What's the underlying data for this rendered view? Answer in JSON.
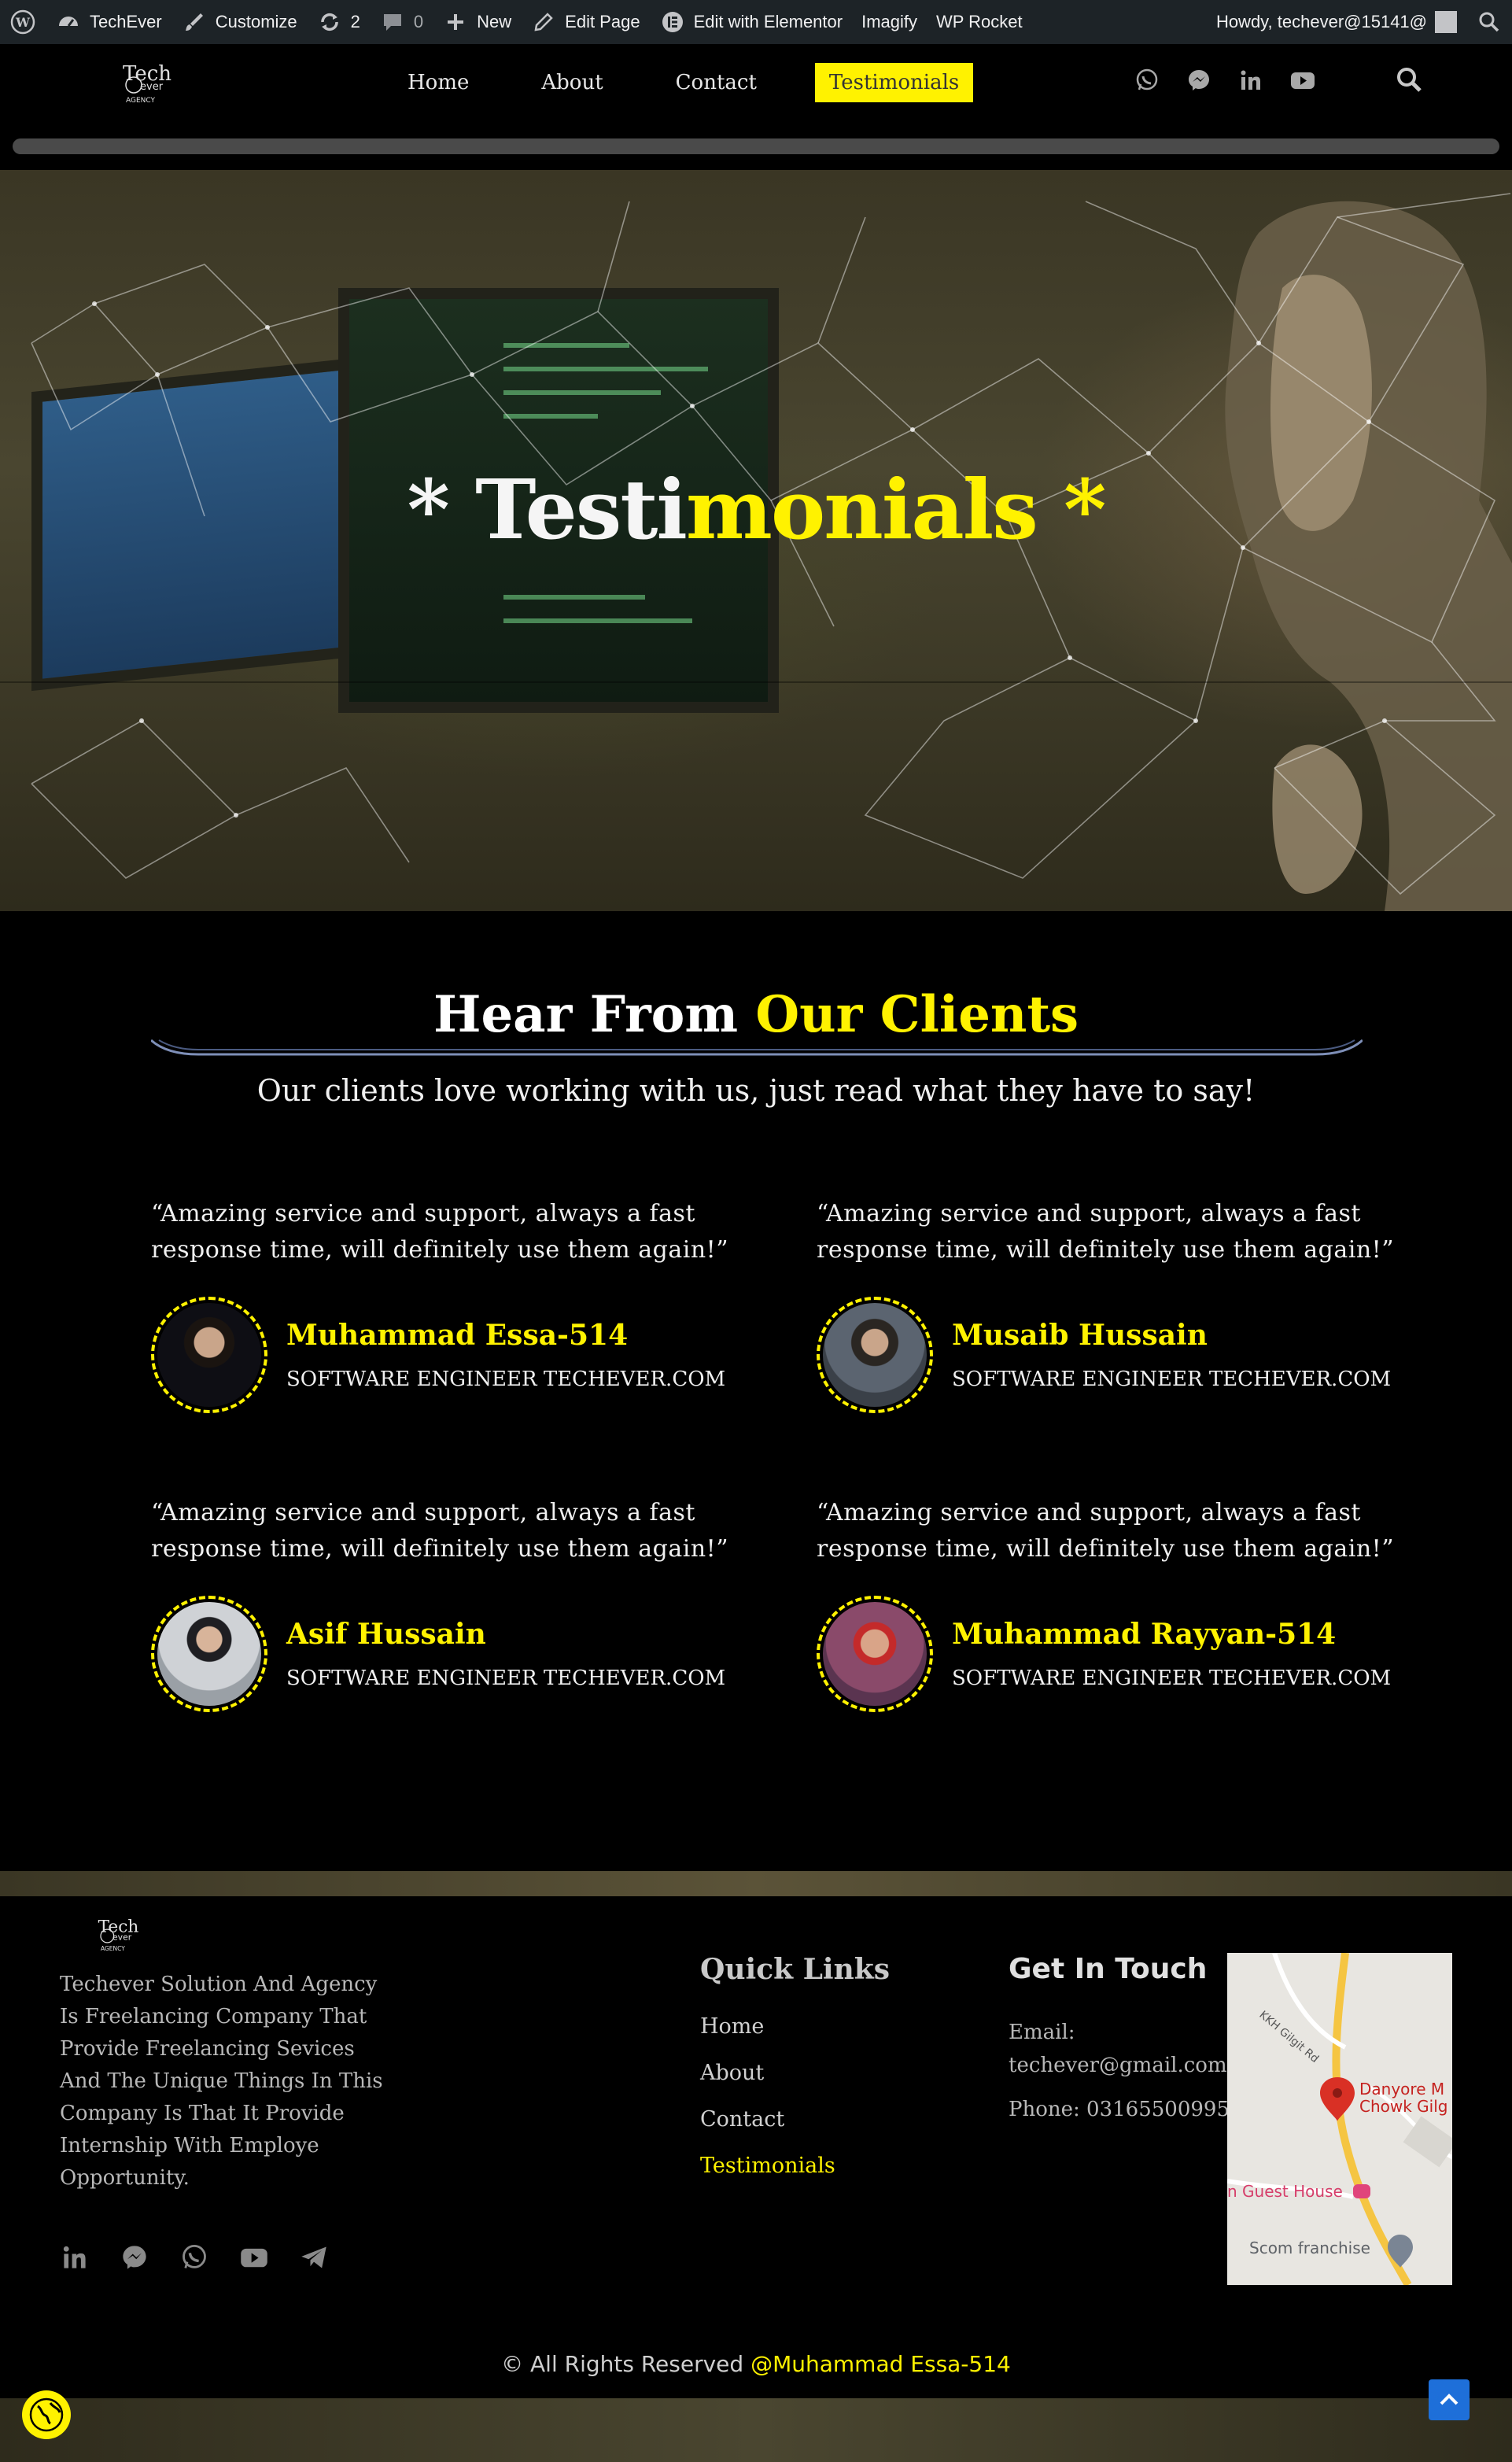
{
  "adminbar": {
    "site_name": "TechEver",
    "customize": "Customize",
    "updates_count": "2",
    "comments_count": "0",
    "new": "New",
    "edit_page": "Edit Page",
    "edit_elementor": "Edit with Elementor",
    "imagify": "Imagify",
    "wp_rocket": "WP Rocket",
    "howdy": "Howdy, techever@15141@"
  },
  "logo": {
    "line1": "Tech",
    "line2": "ever",
    "line3": "AGENCY"
  },
  "nav": {
    "items": [
      {
        "label": "Home",
        "active": false
      },
      {
        "label": "About",
        "active": false
      },
      {
        "label": "Contact",
        "active": false
      },
      {
        "label": "Testimonials",
        "active": true
      }
    ]
  },
  "social_top": [
    "whatsapp-icon",
    "messenger-icon",
    "linkedin-icon",
    "youtube-icon"
  ],
  "hero": {
    "title_pre": "* Testi",
    "title_highlight": "monials *"
  },
  "clients": {
    "title_white": "Hear From ",
    "title_yellow": "Our Clients",
    "subtitle": "Our clients love working with us, just read what they have to say!",
    "testimonials": [
      {
        "quote": "“Amazing service and support, always a fast response time, will definitely use them again!”",
        "name": "Muhammad Essa-514",
        "role": "SOFTWARE ENGINEER TECHEVER.COM"
      },
      {
        "quote": "“Amazing service and support, always a fast response time, will definitely use them again!”",
        "name": "Musaib Hussain",
        "role": "SOFTWARE ENGINEER TECHEVER.COM"
      },
      {
        "quote": "“Amazing service and support, always a fast response time, will definitely use them again!”",
        "name": "Asif Hussain",
        "role": "SOFTWARE ENGINEER TECHEVER.COM"
      },
      {
        "quote": "“Amazing service and support, always a fast response time, will definitely use them again!”",
        "name": "Muhammad Rayyan-514",
        "role": "SOFTWARE ENGINEER TECHEVER.COM"
      }
    ]
  },
  "footer": {
    "about": "Techever Solution And Agency Is Freelancing Company That Provide Freelancing Sevices And The Unique Things In This Company Is That It Provide Internship With Employe Opportunity.",
    "quick_links_title": "Quick Links",
    "quick_links": [
      {
        "label": "Home",
        "active": false
      },
      {
        "label": "About",
        "active": false
      },
      {
        "label": "Contact",
        "active": false
      },
      {
        "label": "Testimonials",
        "active": true
      }
    ],
    "get_in_touch_title": "Get In Touch",
    "email_label": "Email:",
    "email": "techever@gmail.com",
    "phone": "Phone: 03165500995",
    "map": {
      "place1": "Danyore M",
      "place1b": "Chowk Gilg",
      "place2": "n Guest House",
      "place3": "Scom franchise",
      "road": "KKH Gilgit Rd"
    },
    "copyright_pre": "© All Rights Reserved ",
    "copyright_author": "@Muhammad Essa-514",
    "social": [
      "linkedin-icon",
      "messenger-icon",
      "whatsapp-icon",
      "youtube-icon",
      "telegram-icon"
    ]
  },
  "colors": {
    "accent": "#fff200",
    "background": "#000000",
    "adminbar": "#1d2327",
    "scroll_top": "#1e6fd9"
  }
}
